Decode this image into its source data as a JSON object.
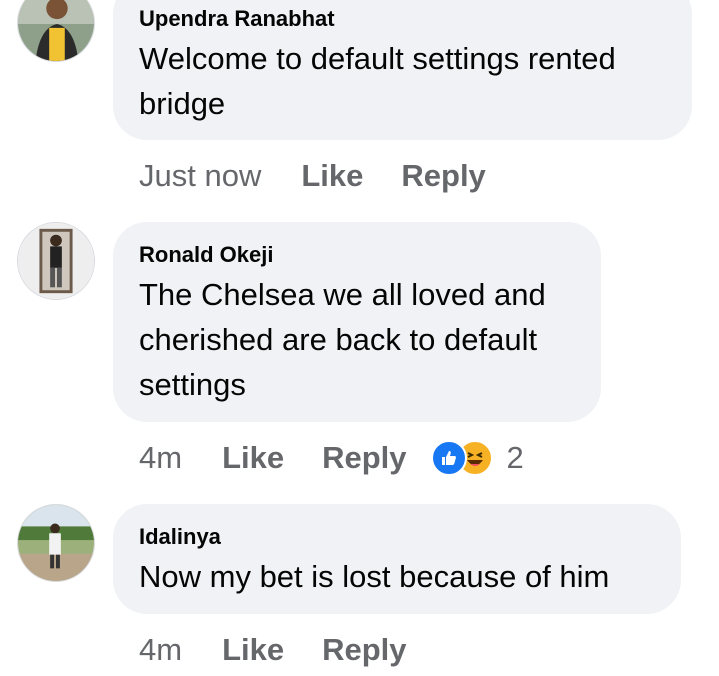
{
  "comments": [
    {
      "author": "Upendra Ranabhat",
      "text": "Welcome to default settings rented bridge",
      "time": "Just now",
      "like_label": "Like",
      "reply_label": "Reply",
      "avatar": "person-photo"
    },
    {
      "author": "Ronald Okeji",
      "text": "The Chelsea we all loved and cherished are back to default settings",
      "time": "4m",
      "like_label": "Like",
      "reply_label": "Reply",
      "avatar": "person-photo",
      "reactions": {
        "icons": [
          "like-icon",
          "haha-icon"
        ],
        "count": "2"
      }
    },
    {
      "author": "Idalinya",
      "text": "Now my bet is lost because of him",
      "time": "4m",
      "like_label": "Like",
      "reply_label": "Reply",
      "avatar": "person-photo"
    }
  ],
  "colors": {
    "bubble": "#f0f2f5",
    "meta_text": "#65676b",
    "like_blue": "#1877f2",
    "haha_yellow": "#f7b125"
  }
}
